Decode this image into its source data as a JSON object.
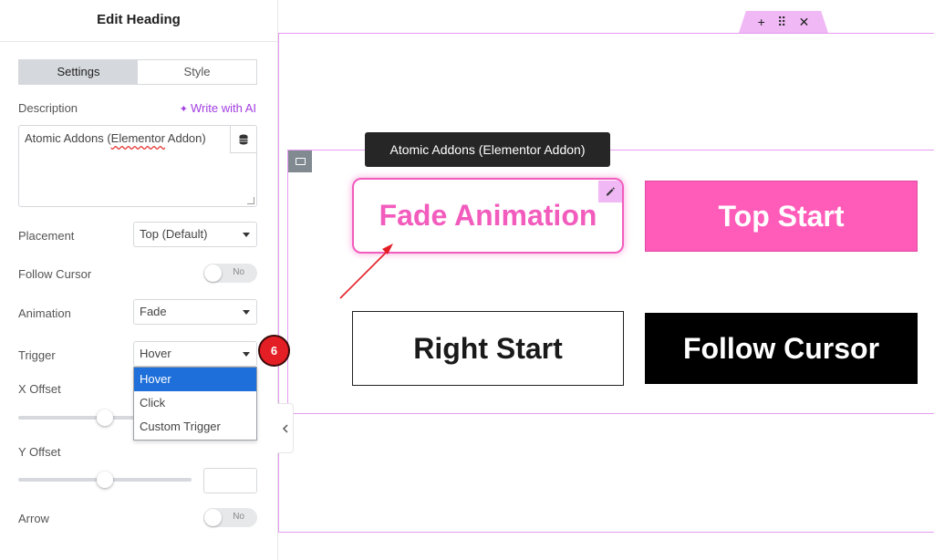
{
  "panel": {
    "title": "Edit Heading",
    "tabs": [
      {
        "label": "Settings",
        "active": true
      },
      {
        "label": "Style",
        "active": false
      }
    ],
    "description_label": "Description",
    "ai_link": "Write with AI",
    "description_value_part1": "Atomic Addons (",
    "description_value_misspelled": "Elementor",
    "description_value_part2": " Addon)",
    "placement_label": "Placement",
    "placement_value": "Top (Default)",
    "follow_cursor_label": "Follow Cursor",
    "follow_cursor_value": "No",
    "animation_label": "Animation",
    "animation_value": "Fade",
    "trigger_label": "Trigger",
    "trigger_value": "Hover",
    "trigger_options": [
      "Hover",
      "Click",
      "Custom Trigger"
    ],
    "x_offset_label": "X Offset",
    "x_offset_slider": 0.5,
    "y_offset_label": "Y Offset",
    "y_offset_slider": 0.5,
    "arrow_label": "Arrow",
    "arrow_value": "No",
    "step_number": "6"
  },
  "canvas": {
    "toolbar": {
      "add": "+",
      "move": "⠿",
      "close": "✕"
    },
    "tooltip_text": "Atomic Addons (Elementor Addon)",
    "buttons": {
      "fade": "Fade Animation",
      "top_start": "Top Start",
      "right_start": "Right Start",
      "follow_cursor": "Follow Cursor"
    }
  },
  "colors": {
    "accent_pink": "#f25cbd",
    "outline_pink": "#e59bf0",
    "ai_purple": "#a33ee0",
    "dropdown_selected": "#1e6fd9",
    "step_badge": "#e31e24"
  }
}
